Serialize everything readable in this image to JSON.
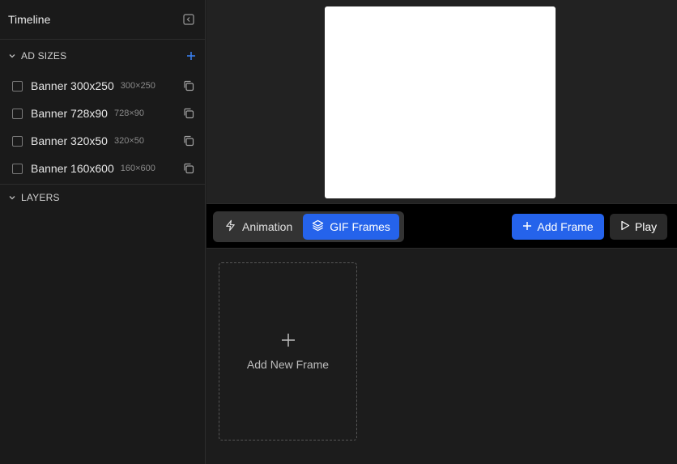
{
  "sidebar": {
    "title": "Timeline",
    "ad_sizes_label": "AD SIZES",
    "layers_label": "LAYERS",
    "sizes": [
      {
        "name": "Banner 300x250",
        "dims": "300×250"
      },
      {
        "name": "Banner 728x90",
        "dims": "728×90"
      },
      {
        "name": "Banner 320x50",
        "dims": "320×50"
      },
      {
        "name": "Banner 160x600",
        "dims": "160×600"
      }
    ]
  },
  "toolbar": {
    "animation_label": "Animation",
    "gif_frames_label": "GIF Frames",
    "active_mode": "GIF Frames",
    "add_frame_label": "Add Frame",
    "play_label": "Play"
  },
  "frames": {
    "add_new_label": "Add New Frame"
  },
  "colors": {
    "accent": "#2563eb",
    "background": "#1c1c1c",
    "toolbar": "#000000"
  },
  "icons": {
    "collapse": "panel-collapse-icon",
    "chevron": "chevron-down-icon",
    "add": "plus-icon",
    "duplicate": "copy-icon",
    "animation": "lightning-icon",
    "gif_frames": "layers-icon",
    "play": "play-icon"
  }
}
